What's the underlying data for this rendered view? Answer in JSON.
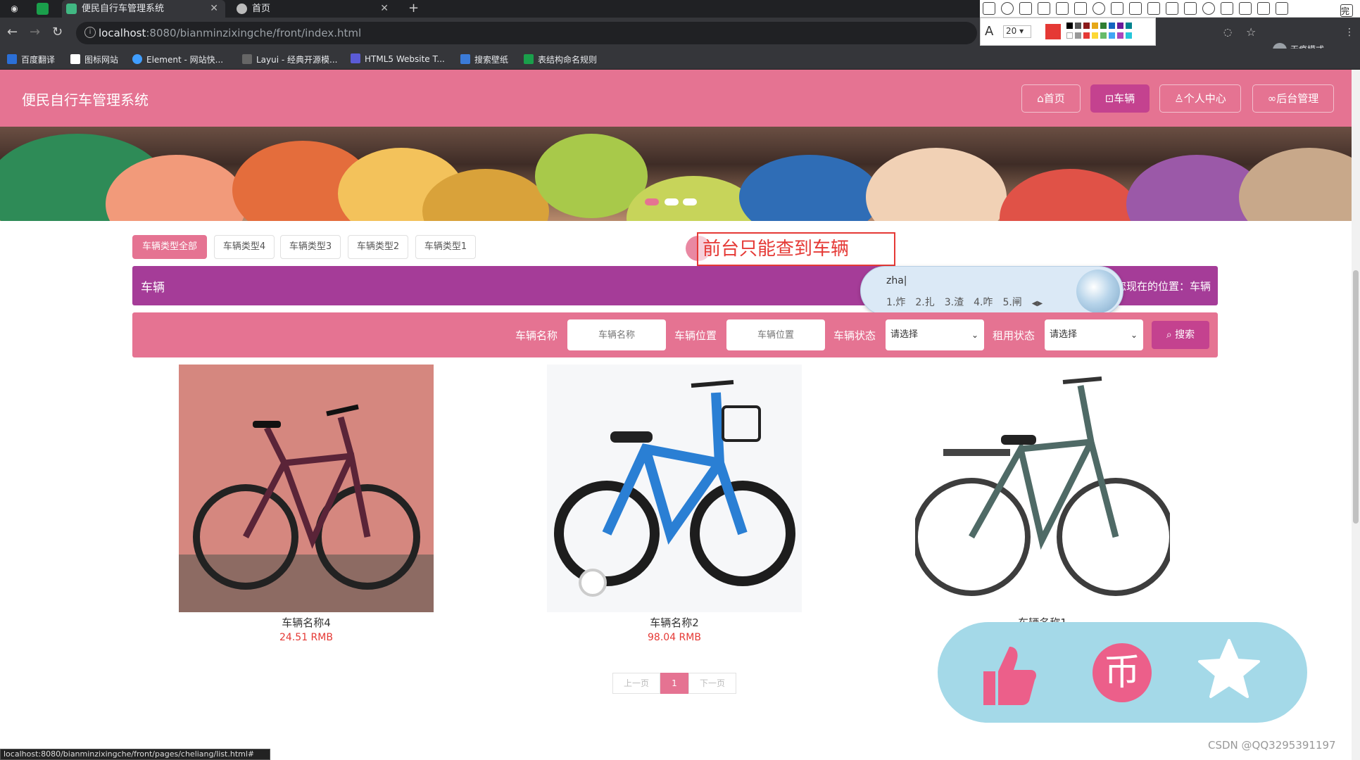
{
  "browser": {
    "tabs": [
      {
        "title": "便民自行车管理系统",
        "active": true
      },
      {
        "title": "首页",
        "active": false
      }
    ],
    "url_host": "localhost",
    "url_path": ":8080/bianminzixingche/front/index.html",
    "incognito_label": "无痕模式",
    "bookmarks": [
      "百度翻译",
      "图标网站",
      "Element - 网站快...",
      "Layui - 经典开源模...",
      "HTML5 Website T...",
      "搜索壁纸",
      "表结构命名规则"
    ],
    "status_url": "localhost:8080/bianminzixingche/front/pages/cheliang/list.html#"
  },
  "annotation_tool": {
    "font_size": "20",
    "done_label": "完成",
    "color": "#e53935"
  },
  "site": {
    "title": "便民自行车管理系统",
    "nav": [
      {
        "icon": "home-icon",
        "label": "首页",
        "active": false
      },
      {
        "icon": "bike-icon",
        "label": "车辆",
        "active": true
      },
      {
        "icon": "user-icon",
        "label": "个人中心",
        "active": false
      },
      {
        "icon": "link-icon",
        "label": "后台管理",
        "active": false
      }
    ],
    "colors": {
      "primary": "#e57392",
      "secondary": "#a53c98",
      "accent": "#c4428f"
    }
  },
  "categories": [
    {
      "label": "车辆类型全部",
      "active": true
    },
    {
      "label": "车辆类型4",
      "active": false
    },
    {
      "label": "车辆类型3",
      "active": false
    },
    {
      "label": "车辆类型2",
      "active": false
    },
    {
      "label": "车辆类型1",
      "active": false
    }
  ],
  "annotation_text": "前台只能查到车辆",
  "section": {
    "title": "车辆",
    "breadcrumb": "您现在的位置：车辆"
  },
  "ime": {
    "input": "zha|",
    "candidates": [
      "1.炸",
      "2.扎",
      "3.渣",
      "4.咋",
      "5.闸"
    ]
  },
  "search": {
    "name_label": "车辆名称",
    "name_placeholder": "车辆名称",
    "location_label": "车辆位置",
    "location_placeholder": "车辆位置",
    "status_label": "车辆状态",
    "status_value": "请选择",
    "rent_label": "租用状态",
    "rent_value": "请选择",
    "button_label": "搜索"
  },
  "products": [
    {
      "name": "车辆名称4",
      "price": "24.51 RMB",
      "image": "dark-red-hybrid-bike-photo"
    },
    {
      "name": "车辆名称2",
      "price": "98.04 RMB",
      "image": "blue-kids-bike-photo"
    },
    {
      "name": "车辆名称1",
      "price": "",
      "image": "green-city-bike-photo"
    }
  ],
  "pagination": {
    "prev": "上一页",
    "current": "1",
    "next": "下一页"
  },
  "watermark": "CSDN @QQ3295391197"
}
